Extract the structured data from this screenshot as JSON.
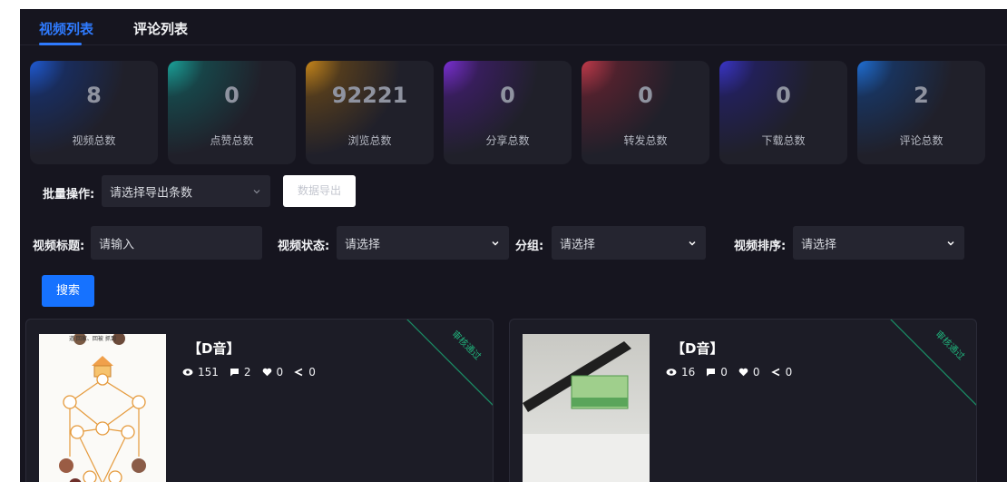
{
  "tabs": [
    {
      "label": "视频列表",
      "active": true
    },
    {
      "label": "评论列表",
      "active": false
    }
  ],
  "stats": [
    {
      "value": "8",
      "label": "视频总数",
      "glow": "#1f5bd6"
    },
    {
      "value": "0",
      "label": "点赞总数",
      "glow": "#1aa39a"
    },
    {
      "value": "92221",
      "label": "浏览总数",
      "glow": "#c7861a"
    },
    {
      "value": "0",
      "label": "分享总数",
      "glow": "#7a2fd4"
    },
    {
      "value": "0",
      "label": "转发总数",
      "glow": "#c23a4a"
    },
    {
      "value": "0",
      "label": "下载总数",
      "glow": "#3a35c9"
    },
    {
      "value": "2",
      "label": "评论总数",
      "glow": "#1f6fd6"
    }
  ],
  "batch": {
    "label": "批量操作:",
    "select_value": "请选择导出条数",
    "export_button": "数据导出"
  },
  "filters": {
    "title_label": "视频标题:",
    "title_placeholder": "请输入",
    "status_label": "视频状态:",
    "status_value": "请选择",
    "group_label": "分组:",
    "group_value": "请选择",
    "sort_label": "视频排序:",
    "sort_value": "请选择",
    "search_button": "搜索"
  },
  "videos": [
    {
      "title": "【D音】",
      "views": "151",
      "comments": "2",
      "likes": "0",
      "shares": "0",
      "status": "审核通过",
      "thumb_caption": "道 回家、回被 抓到"
    },
    {
      "title": "【D音】",
      "views": "16",
      "comments": "0",
      "likes": "0",
      "shares": "0",
      "status": "审核通过"
    }
  ],
  "colors": {
    "accent": "#2f7bff",
    "background": "#16151f",
    "status_green": "#20b07a"
  }
}
